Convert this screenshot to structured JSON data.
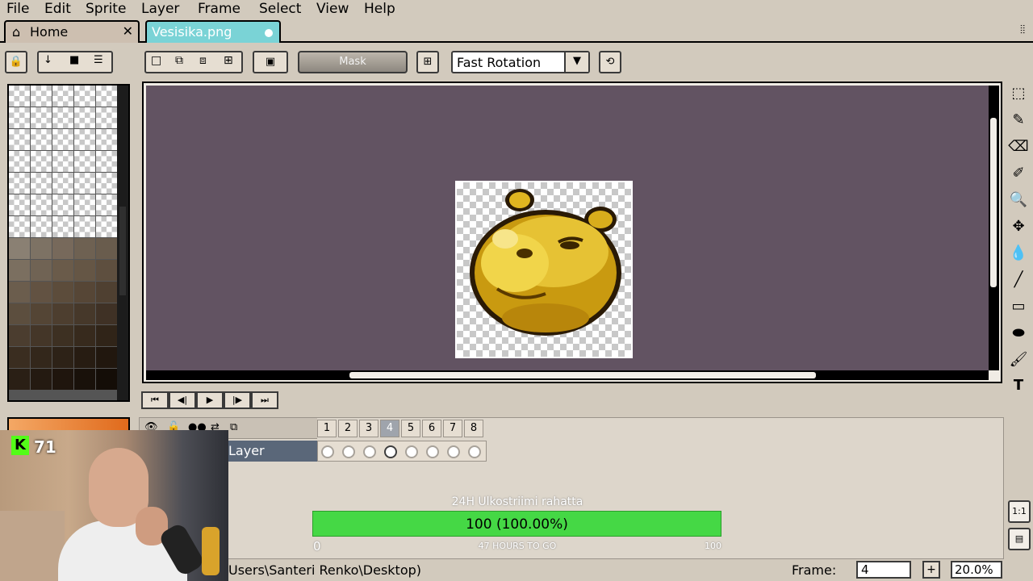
{
  "menu": [
    "File",
    "Edit",
    "Sprite",
    "Layer",
    "Frame",
    "Select",
    "View",
    "Help"
  ],
  "tabs": {
    "home": "Home",
    "home_close": "✕",
    "file": "Vesisika.png"
  },
  "toolbar": {
    "mask_label": "Mask",
    "rotation_algorithm": "Fast Rotation"
  },
  "icons": {
    "lock": "🔒",
    "download": "↓",
    "stop": "■",
    "menu": "☰",
    "select_new": "□",
    "select_add": "⧉",
    "select_sub": "⧈",
    "select_int": "⊞",
    "transparent": "▣",
    "pivot": "⊞",
    "dropdown": "▼",
    "rotate_tool": "⟲"
  },
  "tools": [
    "⬚",
    "✎",
    "⌫",
    "✐",
    "🔍",
    "✥",
    "💧",
    "╱",
    "▭",
    "⬬",
    "🖌",
    "T"
  ],
  "playback": [
    "⏮",
    "◀|",
    "▶",
    "|▶",
    "⏭"
  ],
  "timeline": {
    "layer_name": "Layer",
    "frames": [
      "1",
      "2",
      "3",
      "4",
      "5",
      "6",
      "7",
      "8"
    ],
    "active_frame": 4
  },
  "stream": {
    "viewer_count": "71",
    "kick_letter": "K",
    "goal_title": "24H Ulkostriimi rahatta",
    "goal_value": "100 (100.00%)",
    "goal_progress": 1.0,
    "goal_min": "0",
    "goal_max": "100",
    "goal_remaining": "47 HOURS TO GO"
  },
  "status": {
    "path": "Users\\Santeri Renko\\Desktop)",
    "frame_label": "Frame:",
    "frame_value": "4",
    "frame_add": "+",
    "zoom": "20.0%"
  },
  "side_buttons": [
    "1:1",
    "▤"
  ],
  "colors": {
    "canvas_bg": "#625362",
    "tab_active": "#7ad3d6",
    "ui_bg": "#d2cabd",
    "goal_bar": "#45d845",
    "kick_green": "#53fc18"
  },
  "palette": [
    "#ffffff",
    "#ffffff",
    "#ffffff",
    "#ffffff",
    "#ffffff",
    "#ffffff",
    "#ffffff",
    "#ffffff",
    "#ffffff",
    "#ffffff",
    "#ffffff",
    "#ffffff",
    "#ffffff",
    "#ffffff",
    "#ffffff",
    "#ffffff",
    "#ffffff",
    "#ffffff",
    "#ffffff",
    "#ffffff",
    "#ffffff",
    "#ffffff",
    "#ffffff",
    "#ffffff",
    "#ffffff",
    "#ffffff",
    "#ffffff",
    "#ffffff",
    "#ffffff",
    "#ffffff",
    "#ffffff",
    "#ffffff",
    "#ffffff",
    "#ffffff",
    "#ffffff",
    "#8a8073",
    "#7d7264",
    "#77695b",
    "#6e6152",
    "#695c4d",
    "#7b6f60",
    "#706354",
    "#6a5b4a",
    "#655645",
    "#5e4f3f",
    "#6b5d4d",
    "#625242",
    "#5c4c3b",
    "#564636",
    "#4f4031",
    "#5c4e3e",
    "#544535",
    "#4d3e2f",
    "#46382a",
    "#3f3125",
    "#4b3d2f",
    "#443628",
    "#3d3022",
    "#372a1d",
    "#302418",
    "#3a2d20",
    "#33271b",
    "#2d2217",
    "#271c12",
    "#21170e",
    "#2a1f15",
    "#241a11",
    "#1f150d",
    "#19110a",
    "#140d07"
  ]
}
